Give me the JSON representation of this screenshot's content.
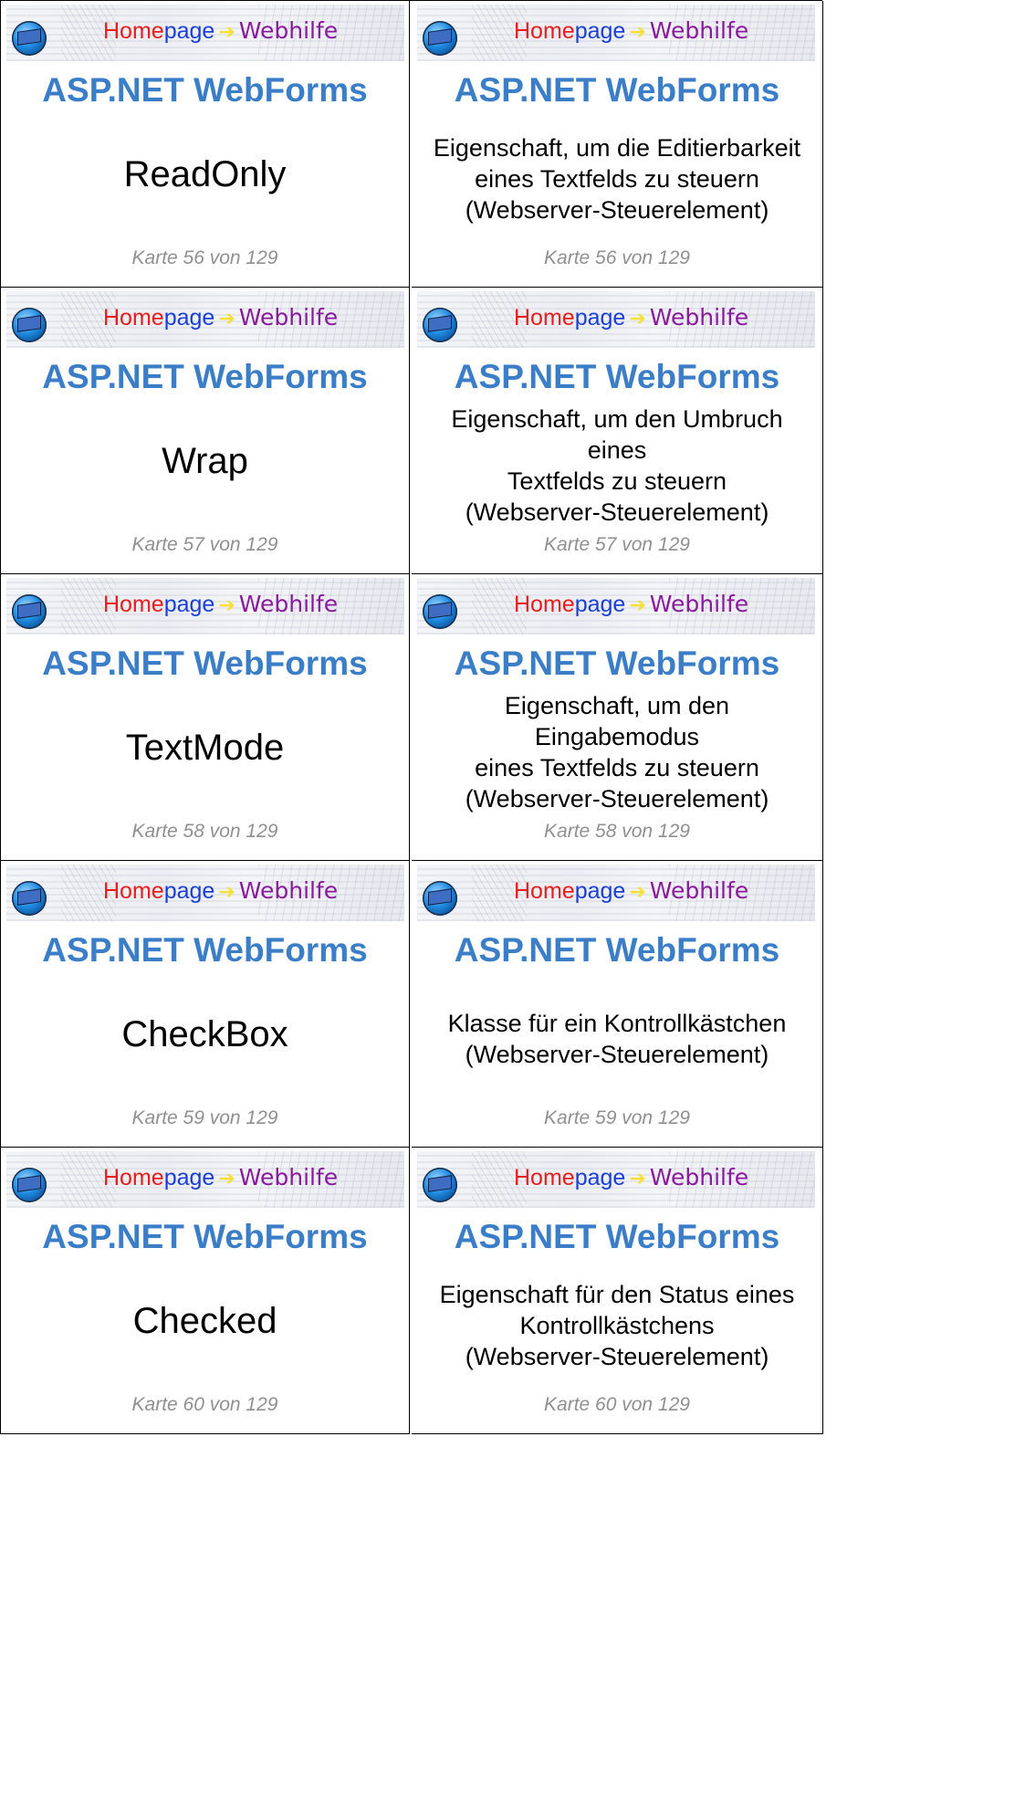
{
  "banner": {
    "home_part1": "Home",
    "home_part2": "page",
    "arrow": "➔",
    "web": "Webhilfe",
    "logo_icon": "homepage-webhilfe-logo-icon"
  },
  "subject": "ASP.NET WebForms",
  "cards": [
    {
      "term": "ReadOnly",
      "description": [
        "Eigenschaft, um die Editierbarkeit",
        "eines Textfelds zu steuern",
        "(Webserver-Steuerelement)"
      ],
      "counter": "Karte 56 von 129"
    },
    {
      "term": "Wrap",
      "description": [
        "Eigenschaft, um den Umbruch eines",
        "Textfelds zu steuern",
        "(Webserver-Steuerelement)"
      ],
      "counter": "Karte 57 von 129"
    },
    {
      "term": "TextMode",
      "description": [
        "Eigenschaft, um den Eingabemodus",
        "eines Textfelds zu steuern",
        "(Webserver-Steuerelement)"
      ],
      "counter": "Karte 58 von 129"
    },
    {
      "term": "CheckBox",
      "description": [
        "Klasse für ein Kontrollkästchen",
        "(Webserver-Steuerelement)"
      ],
      "counter": "Karte 59 von 129"
    },
    {
      "term": "Checked",
      "description": [
        "Eigenschaft für den Status eines",
        "Kontrollkästchens",
        "(Webserver-Steuerelement)"
      ],
      "counter": "Karte 60 von 129"
    }
  ]
}
